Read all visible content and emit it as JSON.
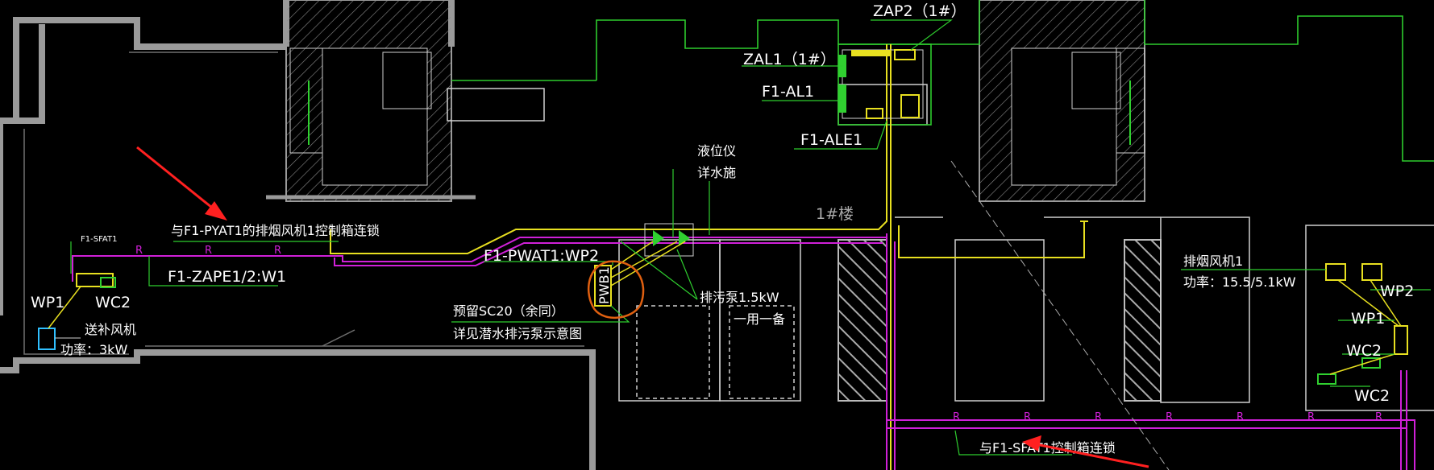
{
  "colors": {
    "background": "#000000",
    "wall": "#9a9a9a",
    "outline": "#2ecc2e",
    "pipe_yellow": "#e8e020",
    "pipe_magenta": "#d020d8",
    "text": "#ffffff",
    "annotation_arrow": "#ff2020",
    "annotation_circle": "#e06010"
  },
  "labels": {
    "zap2": "ZAP2（1#）",
    "zal1": "ZAL1（1#）",
    "f1_al1": "F1-AL1",
    "f1_ale1": "F1-ALE1",
    "level_meter": "液位仪",
    "see_water": "详水施",
    "building_1": "1#楼",
    "f1_pyat1": "与F1-PYAT1的排烟风机1控制箱连锁",
    "f1_sfat1_small": "F1-SFAT1",
    "f1_zape": "F1-ZAPE1/2:W1",
    "f1_pwat1": "F1-PWAT1:WP2",
    "pwb1": "PWB1",
    "sewage_pump": "排污泵1.5kW",
    "one_use_one_spare": "一用一备",
    "reserved_sc20": "预留SC20（余同）",
    "see_diagram": "详见潜水排污泵示意图",
    "wp1_left": "WP1",
    "wc2_left": "WC2",
    "supply_fan": "送补风机",
    "power_3kw": "功率：3kW",
    "exhaust_fan": "排烟风机1",
    "power_exhaust": "功率：15.5/5.1kW",
    "wp2_right": "WP2",
    "wp1_right": "WP1",
    "wc2_right_upper": "WC2",
    "wc2_right_lower": "WC2",
    "f1_sfat1_bottom": "与F1-SFAT1控制箱连锁",
    "pipe_r": "R"
  }
}
